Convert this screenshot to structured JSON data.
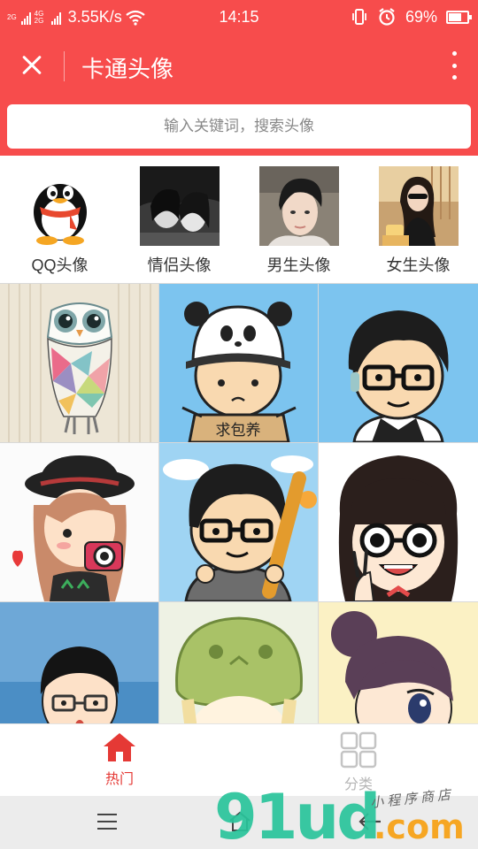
{
  "status_bar": {
    "net1": "2G",
    "net2": "4G 2G",
    "speed": "3.55K/s",
    "time": "14:15",
    "battery_text": "69%",
    "battery_level": 0.69
  },
  "header": {
    "title": "卡通头像",
    "bg_color": "#f74c4c"
  },
  "search": {
    "placeholder": "输入关键词，搜索头像"
  },
  "categories": [
    {
      "label": "QQ头像",
      "icon": "qq-penguin"
    },
    {
      "label": "情侣头像",
      "icon": "couple-photo"
    },
    {
      "label": "男生头像",
      "icon": "boy-photo"
    },
    {
      "label": "女生头像",
      "icon": "girl-photo"
    }
  ],
  "grid": {
    "tiles": [
      {
        "subject": "geometric-owl"
      },
      {
        "subject": "panda-hat-boy",
        "sign_text": "求包养"
      },
      {
        "subject": "glasses-boy"
      },
      {
        "subject": "girl-with-camera"
      },
      {
        "subject": "boy-with-bat"
      },
      {
        "subject": "glasses-girl-peace"
      },
      {
        "subject": "glasses-boy-bowtie"
      },
      {
        "subject": "green-hat-girl"
      },
      {
        "subject": "bun-hair-girl"
      }
    ]
  },
  "tabs": [
    {
      "label": "热门",
      "icon": "home-icon",
      "active": true,
      "color": "#e53935"
    },
    {
      "label": "分类",
      "icon": "grid-icon",
      "active": false,
      "color": "#b5b5b5"
    }
  ],
  "watermark": {
    "brand": "91ud",
    "suffix": ".com",
    "tagline": "小程序商店"
  }
}
